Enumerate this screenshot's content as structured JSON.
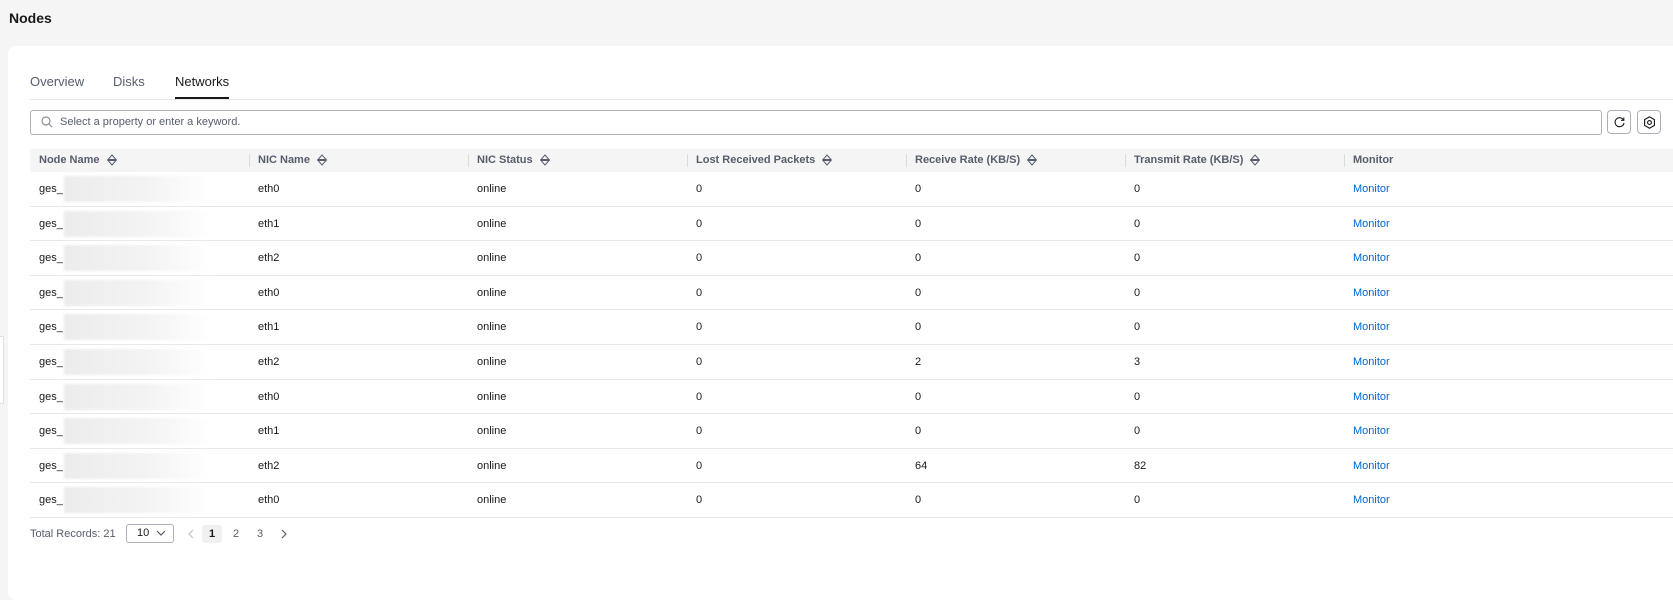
{
  "page": {
    "title": "Nodes"
  },
  "tabs": [
    {
      "label": "Overview",
      "active": false
    },
    {
      "label": "Disks",
      "active": false
    },
    {
      "label": "Networks",
      "active": true
    }
  ],
  "search": {
    "placeholder": "Select a property or enter a keyword.",
    "value": ""
  },
  "toolbar": {
    "refresh_icon": "refresh-icon",
    "settings_icon": "gear-icon"
  },
  "table": {
    "columns": [
      "Node Name",
      "NIC Name",
      "NIC Status",
      "Lost Received Packets",
      "Receive Rate (KB/S)",
      "Transmit Rate (KB/S)",
      "Monitor"
    ],
    "rows": [
      {
        "node": "ges_",
        "nic": "eth0",
        "status": "online",
        "lost": "0",
        "rx": "0",
        "tx": "0",
        "monitor": "Monitor"
      },
      {
        "node": "ges_",
        "nic": "eth1",
        "status": "online",
        "lost": "0",
        "rx": "0",
        "tx": "0",
        "monitor": "Monitor"
      },
      {
        "node": "ges_",
        "nic": "eth2",
        "status": "online",
        "lost": "0",
        "rx": "0",
        "tx": "0",
        "monitor": "Monitor"
      },
      {
        "node": "ges_",
        "nic": "eth0",
        "status": "online",
        "lost": "0",
        "rx": "0",
        "tx": "0",
        "monitor": "Monitor"
      },
      {
        "node": "ges_",
        "nic": "eth1",
        "status": "online",
        "lost": "0",
        "rx": "0",
        "tx": "0",
        "monitor": "Monitor"
      },
      {
        "node": "ges_",
        "nic": "eth2",
        "status": "online",
        "lost": "0",
        "rx": "2",
        "tx": "3",
        "monitor": "Monitor"
      },
      {
        "node": "ges_",
        "nic": "eth0",
        "status": "online",
        "lost": "0",
        "rx": "0",
        "tx": "0",
        "monitor": "Monitor"
      },
      {
        "node": "ges_",
        "nic": "eth1",
        "status": "online",
        "lost": "0",
        "rx": "0",
        "tx": "0",
        "monitor": "Monitor"
      },
      {
        "node": "ges_",
        "nic": "eth2",
        "status": "online",
        "lost": "0",
        "rx": "64",
        "tx": "82",
        "monitor": "Monitor"
      },
      {
        "node": "ges_",
        "nic": "eth0",
        "status": "online",
        "lost": "0",
        "rx": "0",
        "tx": "0",
        "monitor": "Monitor"
      }
    ]
  },
  "pagination": {
    "total_label": "Total Records: 21",
    "page_size": "10",
    "pages": [
      "1",
      "2",
      "3"
    ],
    "current_page": "1"
  },
  "colors": {
    "link": "#0067d1",
    "text": "#191919",
    "muted": "#575d6c"
  }
}
